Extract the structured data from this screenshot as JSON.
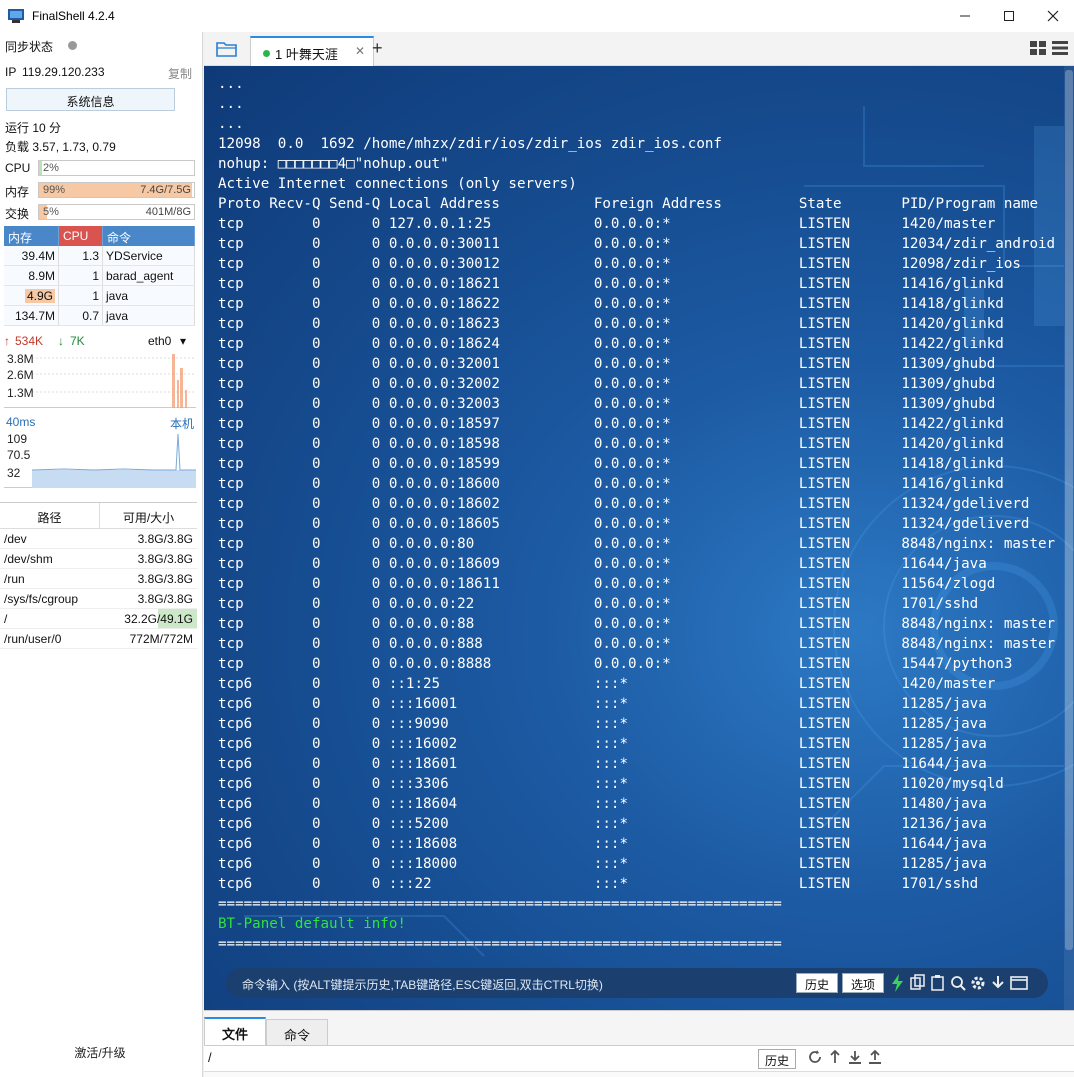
{
  "window": {
    "title": "FinalShell 4.2.4"
  },
  "sidebar": {
    "sync_label": "同步状态",
    "ip_label": "IP",
    "ip": "119.29.120.233",
    "copy_label": "复制",
    "sysinfo_button": "系统信息",
    "uptime": "运行 10 分",
    "load": "负载 3.57, 1.73, 0.79",
    "cpu": {
      "label": "CPU",
      "pct": "2%",
      "fraction": 0.02
    },
    "mem": {
      "label": "内存",
      "pct": "99%",
      "amount": "7.4G/7.5G",
      "fraction": 0.99
    },
    "swap": {
      "label": "交换",
      "pct": "5%",
      "amount": "401M/8G",
      "fraction": 0.05
    },
    "proc_headers": [
      "内存",
      "CPU",
      "命令"
    ],
    "processes": [
      {
        "mem": "39.4M",
        "cpu": "1.3",
        "cmd": "YDService"
      },
      {
        "mem": "8.9M",
        "cpu": "1",
        "cmd": "barad_agent"
      },
      {
        "mem": "4.9G",
        "cpu": "1",
        "cmd": "java"
      },
      {
        "mem": "134.7M",
        "cpu": "0.7",
        "cmd": "java"
      }
    ],
    "net": {
      "up": "534K",
      "down": "7K",
      "iface": "eth0",
      "ticks": [
        "3.8M",
        "2.6M",
        "1.3M"
      ]
    },
    "ping": {
      "ms": "40ms",
      "target": "本机",
      "ticks": [
        "109",
        "70.5",
        "32"
      ]
    },
    "disk_headers": [
      "路径",
      "可用/大小"
    ],
    "disks": [
      {
        "path": "/dev",
        "size": "3.8G/3.8G"
      },
      {
        "path": "/dev/shm",
        "size": "3.8G/3.8G"
      },
      {
        "path": "/run",
        "size": "3.8G/3.8G"
      },
      {
        "path": "/sys/fs/cgroup",
        "size": "3.8G/3.8G"
      },
      {
        "path": "/",
        "size": "32.2G/49.1G"
      },
      {
        "path": "/run/user/0",
        "size": "772M/772M"
      }
    ],
    "upgrade_label": "激活/升级"
  },
  "tabs": [
    {
      "label": "1 叶舞天涯"
    }
  ],
  "terminal": {
    "lines": [
      "...",
      "...",
      "...",
      "12098  0.0  1692 /home/mhzx/zdir/ios/zdir_ios zdir_ios.conf",
      "nohup: □□□□□□□4□\"nohup.out\"",
      "Active Internet connections (only servers)",
      "Proto Recv-Q Send-Q Local Address           Foreign Address         State       PID/Program name",
      "tcp        0      0 127.0.0.1:25            0.0.0.0:*               LISTEN      1420/master",
      "tcp        0      0 0.0.0.0:30011           0.0.0.0:*               LISTEN      12034/zdir_android",
      "tcp        0      0 0.0.0.0:30012           0.0.0.0:*               LISTEN      12098/zdir_ios",
      "tcp        0      0 0.0.0.0:18621           0.0.0.0:*               LISTEN      11416/glinkd",
      "tcp        0      0 0.0.0.0:18622           0.0.0.0:*               LISTEN      11418/glinkd",
      "tcp        0      0 0.0.0.0:18623           0.0.0.0:*               LISTEN      11420/glinkd",
      "tcp        0      0 0.0.0.0:18624           0.0.0.0:*               LISTEN      11422/glinkd",
      "tcp        0      0 0.0.0.0:32001           0.0.0.0:*               LISTEN      11309/ghubd",
      "tcp        0      0 0.0.0.0:32002           0.0.0.0:*               LISTEN      11309/ghubd",
      "tcp        0      0 0.0.0.0:32003           0.0.0.0:*               LISTEN      11309/ghubd",
      "tcp        0      0 0.0.0.0:18597           0.0.0.0:*               LISTEN      11422/glinkd",
      "tcp        0      0 0.0.0.0:18598           0.0.0.0:*               LISTEN      11420/glinkd",
      "tcp        0      0 0.0.0.0:18599           0.0.0.0:*               LISTEN      11418/glinkd",
      "tcp        0      0 0.0.0.0:18600           0.0.0.0:*               LISTEN      11416/glinkd",
      "tcp        0      0 0.0.0.0:18602           0.0.0.0:*               LISTEN      11324/gdeliverd",
      "tcp        0      0 0.0.0.0:18605           0.0.0.0:*               LISTEN      11324/gdeliverd",
      "tcp        0      0 0.0.0.0:80              0.0.0.0:*               LISTEN      8848/nginx: master",
      "tcp        0      0 0.0.0.0:18609           0.0.0.0:*               LISTEN      11644/java",
      "tcp        0      0 0.0.0.0:18611           0.0.0.0:*               LISTEN      11564/zlogd",
      "tcp        0      0 0.0.0.0:22              0.0.0.0:*               LISTEN      1701/sshd",
      "tcp        0      0 0.0.0.0:88              0.0.0.0:*               LISTEN      8848/nginx: master",
      "tcp        0      0 0.0.0.0:888             0.0.0.0:*               LISTEN      8848/nginx: master",
      "tcp        0      0 0.0.0.0:8888            0.0.0.0:*               LISTEN      15447/python3",
      "tcp6       0      0 ::1:25                  :::*                    LISTEN      1420/master",
      "tcp6       0      0 :::16001                :::*                    LISTEN      11285/java",
      "tcp6       0      0 :::9090                 :::*                    LISTEN      11285/java",
      "tcp6       0      0 :::16002                :::*                    LISTEN      11285/java",
      "tcp6       0      0 :::18601                :::*                    LISTEN      11644/java",
      "tcp6       0      0 :::3306                 :::*                    LISTEN      11020/mysqld",
      "tcp6       0      0 :::18604                :::*                    LISTEN      11480/java",
      "tcp6       0      0 :::5200                 :::*                    LISTEN      12136/java",
      "tcp6       0      0 :::18608                :::*                    LISTEN      11644/java",
      "tcp6       0      0 :::18000                :::*                    LISTEN      11285/java",
      "tcp6       0      0 :::22                   :::*                    LISTEN      1701/sshd",
      "==================================================================",
      "BT-Panel default info!",
      "=================================================================="
    ]
  },
  "command_bar": {
    "hint": "命令输入 (按ALT键提示历史,TAB键路径,ESC键返回,双击CTRL切换)",
    "history_button": "历史",
    "options_button": "选项"
  },
  "bottom": {
    "tab_file": "文件",
    "tab_cmd": "命令",
    "path": "/",
    "history_button": "历史"
  },
  "colors": {
    "accent": "#2a8be0",
    "mem_fill": "#f6c9a4",
    "cpu_fill": "#b9e3b5",
    "term_green": "#2ee33b"
  }
}
